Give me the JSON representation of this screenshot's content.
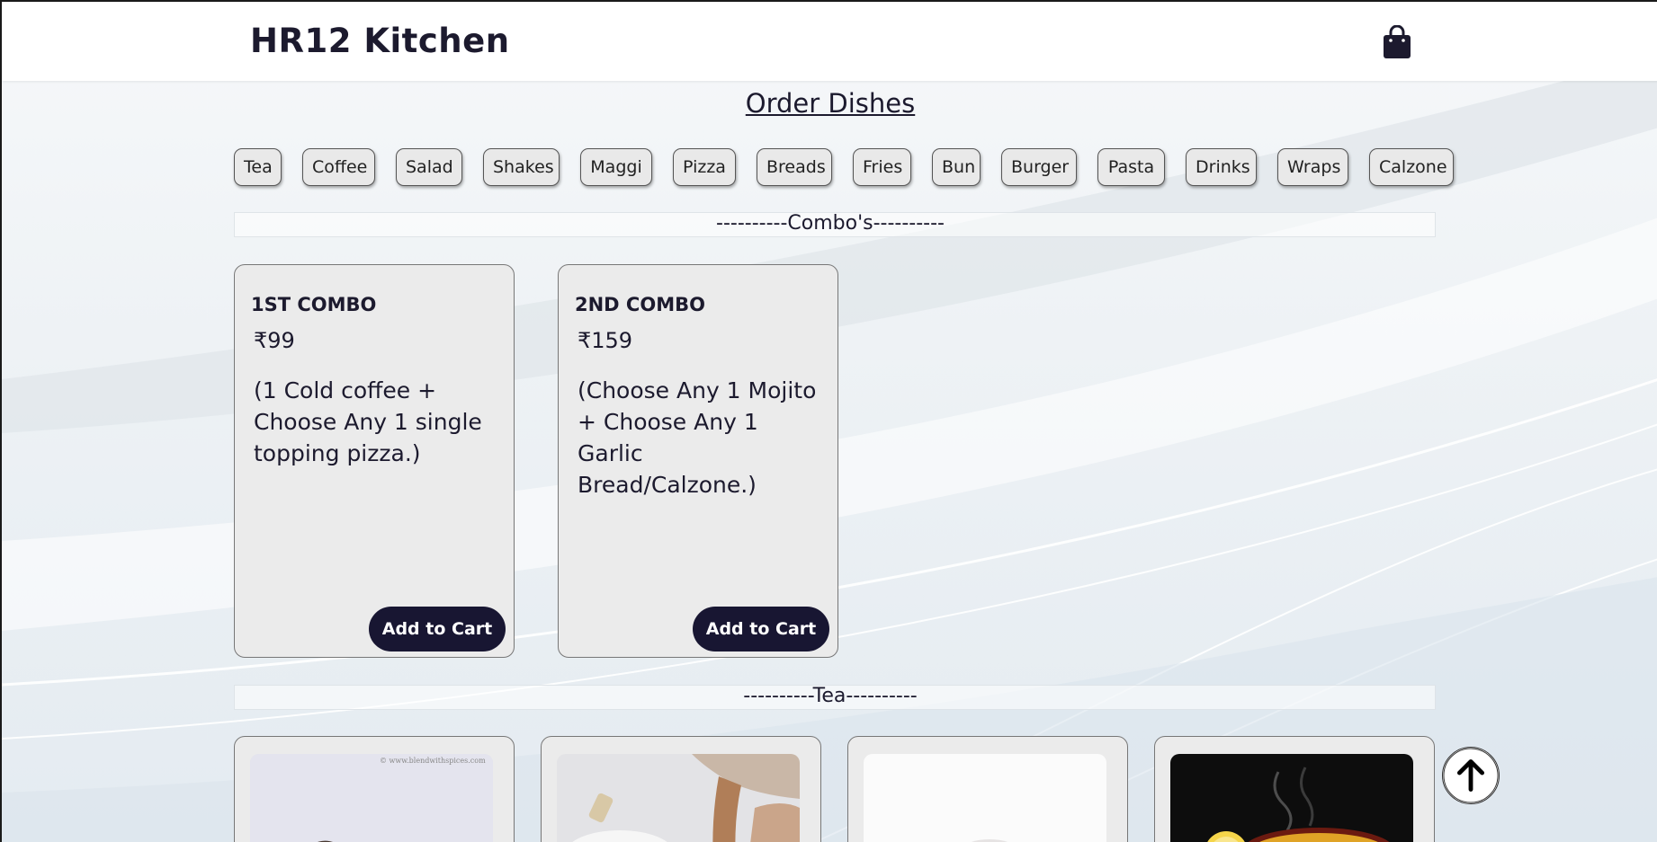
{
  "header": {
    "brand": "HR12 Kitchen",
    "cart_icon": "shopping-bag-icon"
  },
  "page_title": "Order Dishes",
  "categories": [
    "Tea",
    "Coffee",
    "Salad",
    "Shakes",
    "Maggi",
    "Pizza",
    "Breads",
    "Fries",
    "Bun",
    "Burger",
    "Pasta",
    "Drinks",
    "Wraps",
    "Calzone"
  ],
  "sections": {
    "combos_label": "----------Combo's----------",
    "tea_label": "----------Tea----------"
  },
  "combos": [
    {
      "name": "1ST COMBO",
      "price": "₹99",
      "description": "(1 Cold coffee + Choose Any 1 single topping pizza.)",
      "button": "Add to Cart"
    },
    {
      "name": "2ND COMBO",
      "price": "₹159",
      "description": "(Choose Any 1 Mojito + Choose Any 1 Garlic Bread/Calzone.)",
      "button": "Add to Cart"
    }
  ],
  "tea_items": [
    {
      "image": "masala-tea-photo",
      "watermark": "© www.blendwithspices.com"
    },
    {
      "image": "tea-pour-photo"
    },
    {
      "image": "tea-cup-photo"
    },
    {
      "image": "lemon-tea-photo"
    }
  ],
  "scroll_top_icon": "arrow-up-icon",
  "colors": {
    "primary_dark": "#181632",
    "card_bg": "#ebebeb",
    "header_bg": "#ffffff"
  }
}
